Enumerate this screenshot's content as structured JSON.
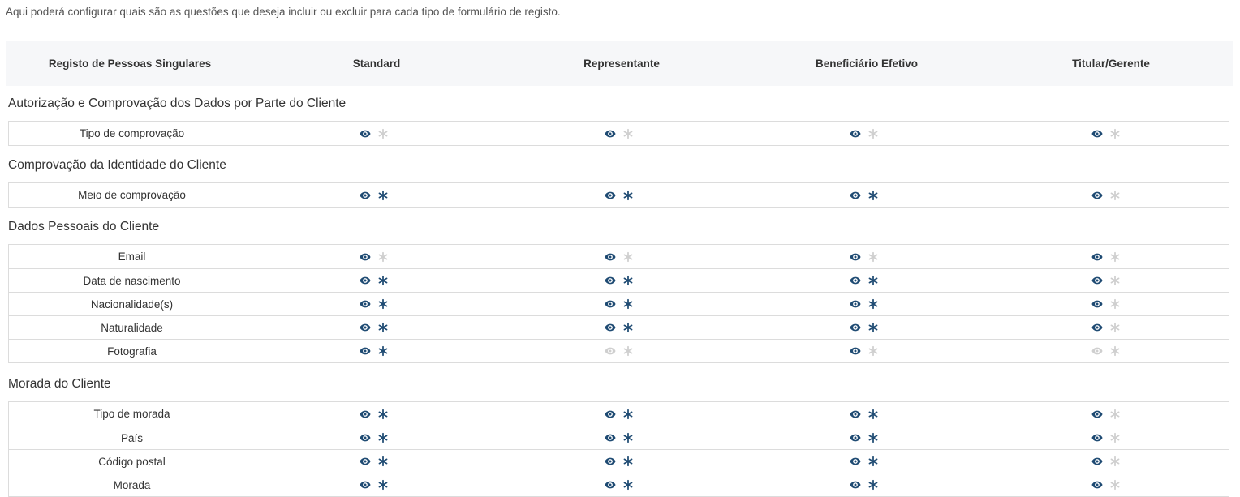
{
  "description": "Aqui poderá configurar quais são as questões que deseja incluir ou excluir para cada tipo de formulário de registo.",
  "columns": [
    "Registo de Pessoas Singulares",
    "Standard",
    "Representante",
    "Beneficiário Efetivo",
    "Titular/Gerente"
  ],
  "sections": [
    {
      "title": "Autorização e Comprovação dos Dados por Parte do Cliente",
      "rows": [
        {
          "label": "Tipo de comprovação",
          "cells": [
            [
              1,
              0
            ],
            [
              1,
              0
            ],
            [
              1,
              0
            ],
            [
              1,
              0
            ]
          ]
        }
      ]
    },
    {
      "title": "Comprovação da Identidade do Cliente",
      "rows": [
        {
          "label": "Meio de comprovação",
          "cells": [
            [
              1,
              1
            ],
            [
              1,
              1
            ],
            [
              1,
              1
            ],
            [
              1,
              0
            ]
          ]
        }
      ]
    },
    {
      "title": "Dados Pessoais do Cliente",
      "rows": [
        {
          "label": "Email",
          "cells": [
            [
              1,
              0
            ],
            [
              1,
              0
            ],
            [
              1,
              0
            ],
            [
              1,
              0
            ]
          ]
        },
        {
          "label": "Data de nascimento",
          "cells": [
            [
              1,
              1
            ],
            [
              1,
              1
            ],
            [
              1,
              1
            ],
            [
              1,
              0
            ]
          ]
        },
        {
          "label": "Nacionalidade(s)",
          "cells": [
            [
              1,
              1
            ],
            [
              1,
              1
            ],
            [
              1,
              1
            ],
            [
              1,
              0
            ]
          ]
        },
        {
          "label": "Naturalidade",
          "cells": [
            [
              1,
              1
            ],
            [
              1,
              1
            ],
            [
              1,
              1
            ],
            [
              1,
              0
            ]
          ]
        },
        {
          "label": "Fotografia",
          "cells": [
            [
              1,
              1
            ],
            [
              0,
              0
            ],
            [
              1,
              0
            ],
            [
              0,
              0
            ]
          ]
        }
      ]
    },
    {
      "title": "Morada do Cliente",
      "rows": [
        {
          "label": "Tipo de morada",
          "cells": [
            [
              1,
              1
            ],
            [
              1,
              1
            ],
            [
              1,
              1
            ],
            [
              1,
              0
            ]
          ]
        },
        {
          "label": "País",
          "cells": [
            [
              1,
              1
            ],
            [
              1,
              1
            ],
            [
              1,
              1
            ],
            [
              1,
              0
            ]
          ]
        },
        {
          "label": "Código postal",
          "cells": [
            [
              1,
              1
            ],
            [
              1,
              1
            ],
            [
              1,
              1
            ],
            [
              1,
              0
            ]
          ]
        },
        {
          "label": "Morada",
          "cells": [
            [
              1,
              1
            ],
            [
              1,
              1
            ],
            [
              1,
              1
            ],
            [
              1,
              0
            ]
          ]
        }
      ]
    }
  ],
  "colors": {
    "active": "#1f4b73",
    "inactive": "#cfcfcf",
    "header_bg": "#f6f7f9"
  },
  "icons": {
    "visibility": "eye-icon",
    "required": "asterisk-icon"
  }
}
